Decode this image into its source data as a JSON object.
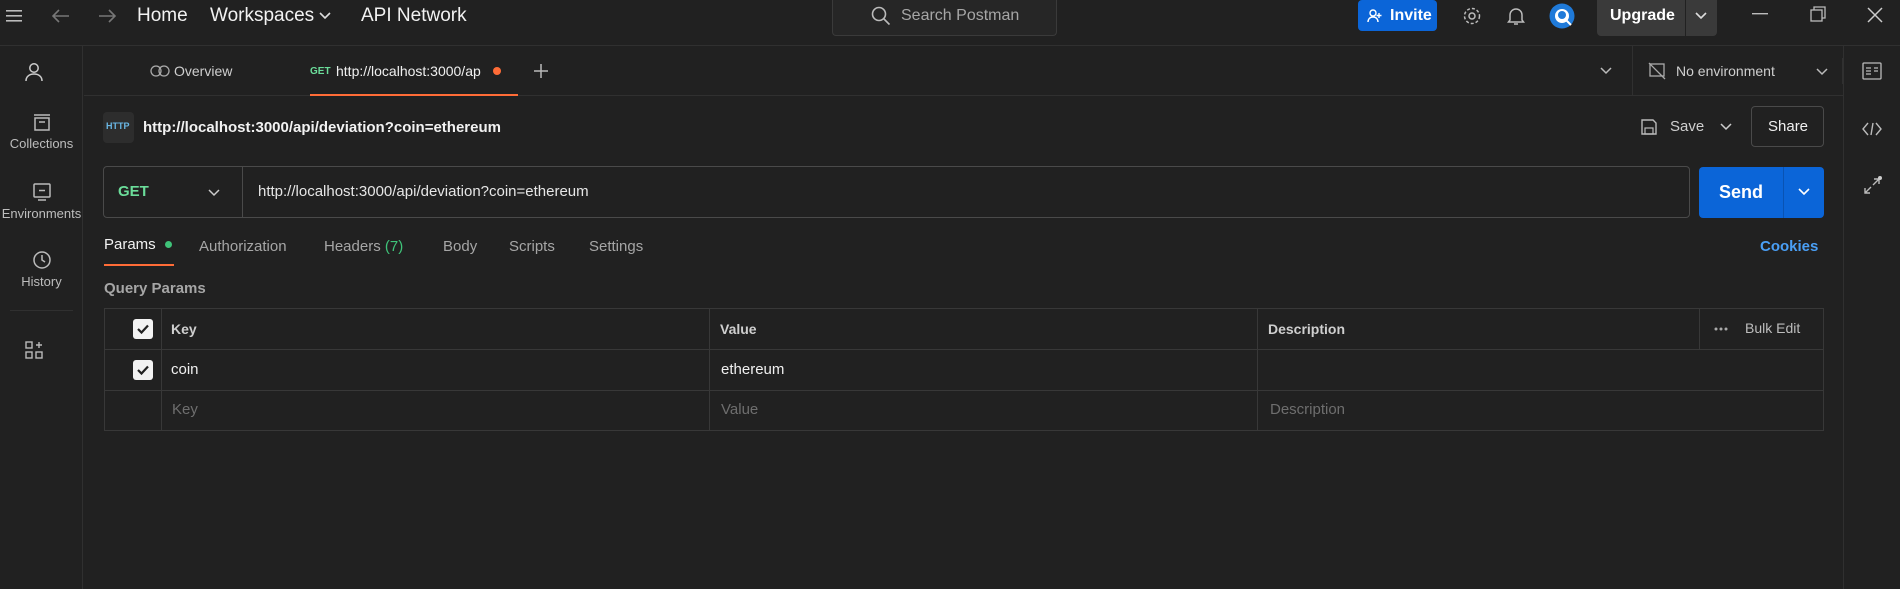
{
  "titlebar": {
    "home": "Home",
    "workspaces": "Workspaces",
    "api_network": "API Network",
    "search_placeholder": "Search Postman",
    "invite": "Invite",
    "upgrade": "Upgrade"
  },
  "sidebar": {
    "items": [
      {
        "label": "Collections",
        "icon": "collections-icon"
      },
      {
        "label": "Environments",
        "icon": "environments-icon"
      },
      {
        "label": "History",
        "icon": "history-icon"
      }
    ]
  },
  "tabs": {
    "overview": "Overview",
    "active_method": "GET",
    "active_title": "http://localhost:3000/ap",
    "environment": "No environment"
  },
  "request": {
    "badge": "HTTP",
    "title": "http://localhost:3000/api/deviation?coin=ethereum",
    "save": "Save",
    "share": "Share",
    "method": "GET",
    "url": "http://localhost:3000/api/deviation?coin=ethereum",
    "send": "Send"
  },
  "subtabs": {
    "params": "Params",
    "authorization": "Authorization",
    "headers": "Headers",
    "headers_count": "(7)",
    "body": "Body",
    "scripts": "Scripts",
    "settings": "Settings",
    "cookies": "Cookies"
  },
  "query_params": {
    "title": "Query Params",
    "headers": {
      "key": "Key",
      "value": "Value",
      "description": "Description",
      "bulk_edit": "Bulk Edit"
    },
    "rows": [
      {
        "key": "coin",
        "value": "ethereum",
        "description": ""
      }
    ],
    "placeholders": {
      "key": "Key",
      "value": "Value",
      "description": "Description"
    }
  },
  "colors": {
    "accent_blue": "#0b65d8",
    "method_green": "#6bdd9a",
    "tab_underline": "#ff6c37",
    "background": "#212121"
  }
}
